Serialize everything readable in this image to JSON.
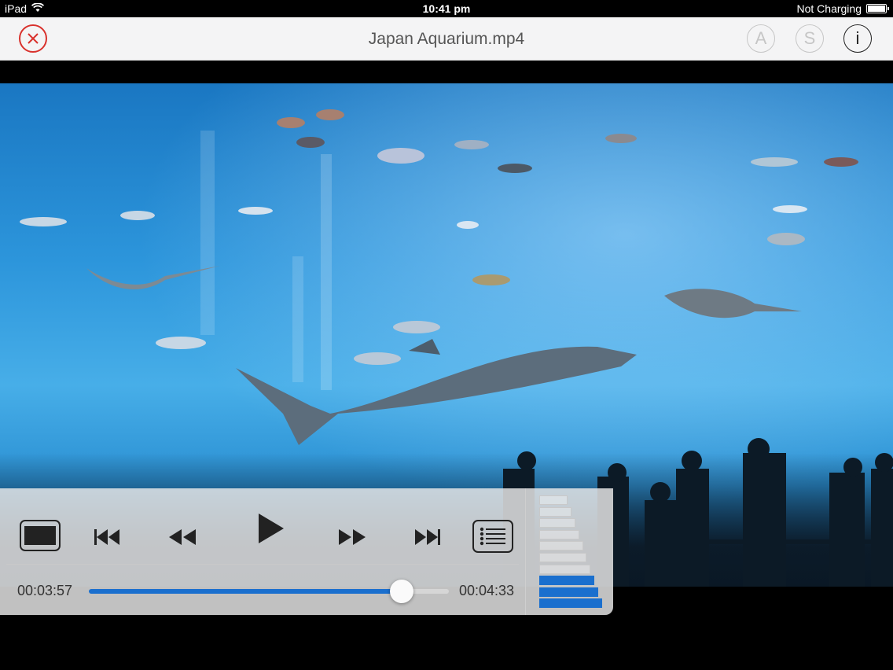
{
  "status_bar": {
    "device": "iPad",
    "time": "10:41 pm",
    "battery_status": "Not Charging"
  },
  "title_bar": {
    "title": "Japan Aquarium.mp4",
    "close_icon": "close-icon",
    "audio_label": "A",
    "subtitle_label": "S",
    "info_label": "i"
  },
  "player": {
    "elapsed": "00:03:57",
    "total": "00:04:33",
    "progress_fraction": 0.87,
    "volume_levels_total": 10,
    "volume_levels_on": 3,
    "accent_color": "#1a6fce"
  },
  "icons": {
    "aspect": "aspect-ratio-icon",
    "prev": "skip-previous-icon",
    "rewind": "rewind-icon",
    "play": "play-icon",
    "forward": "fast-forward-icon",
    "next": "skip-next-icon",
    "playlist": "playlist-icon"
  }
}
